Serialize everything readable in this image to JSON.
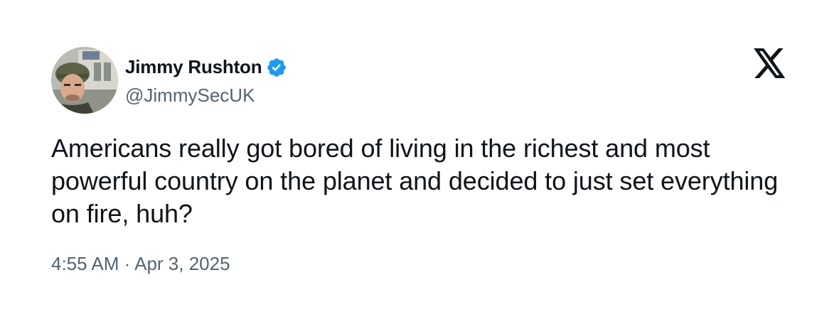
{
  "author": {
    "display_name": "Jimmy Rushton",
    "handle": "@JimmySecUK",
    "verified": true,
    "verified_icon": "verified-badge-icon",
    "verified_color": "#1d9bf0"
  },
  "brand": {
    "logo": "x-logo-icon",
    "color": "#0f1419"
  },
  "tweet": {
    "text": "Americans really got bored of living in the richest and most powerful country on the planet and decided to just set everything on fire, huh?",
    "time": "4:55 AM",
    "separator": "·",
    "date": "Apr 3, 2025"
  },
  "colors": {
    "primary_text": "#0f1419",
    "secondary_text": "#536471",
    "background": "#ffffff"
  }
}
